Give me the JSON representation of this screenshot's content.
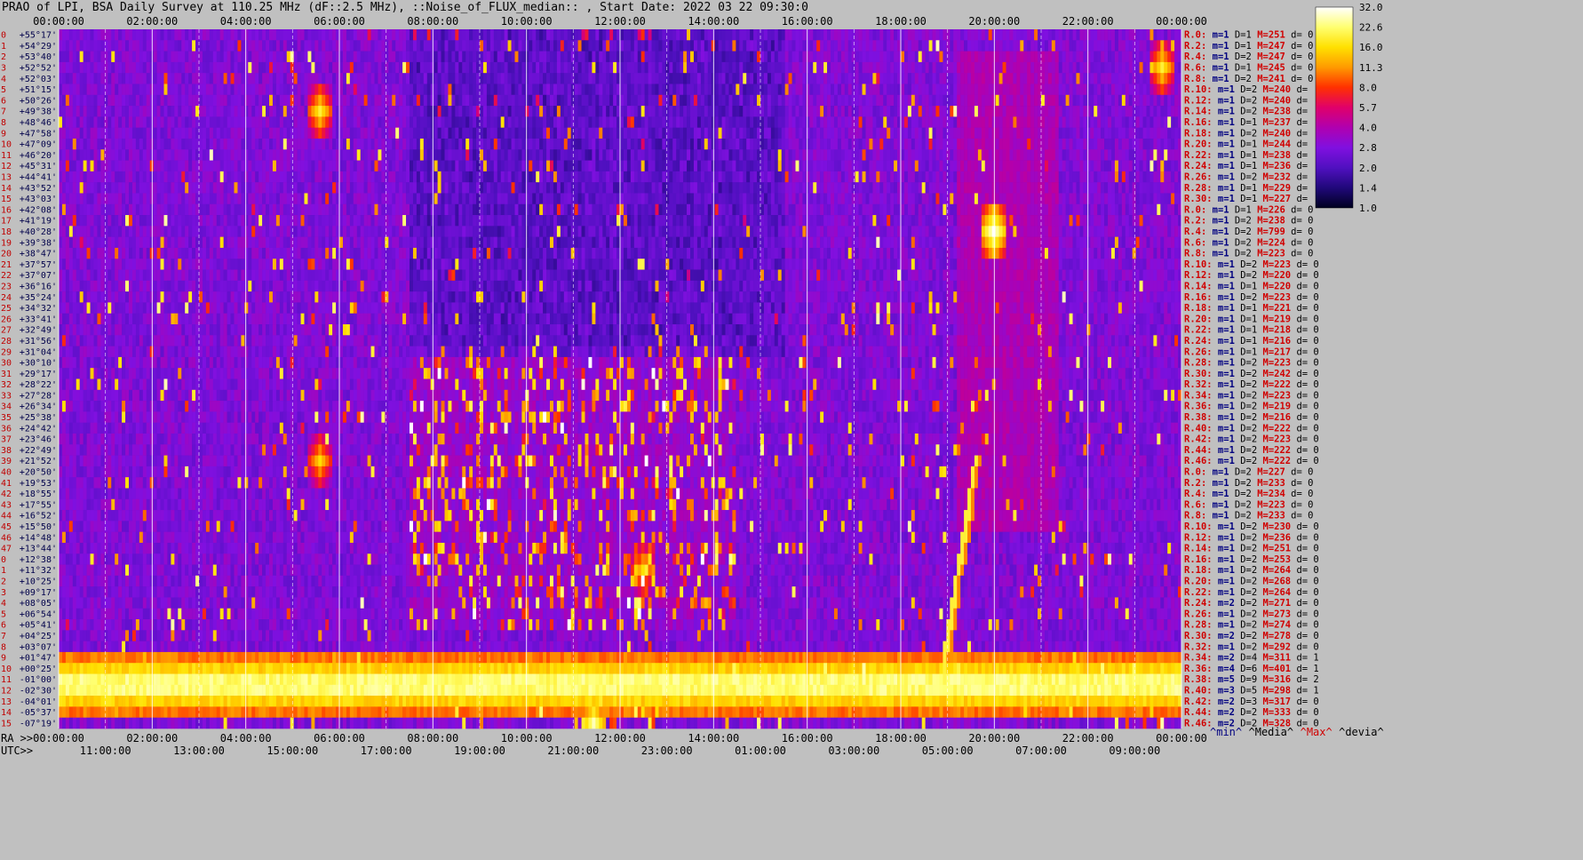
{
  "title": "PRAO of LPI, BSA Daily Survey at 110.25 MHz (dF::2.5 MHz), ::Noise_of_FLUX_median:: , Start Date: 2022 03 22 09:30:0",
  "chart_data": {
    "type": "heatmap",
    "title": "PRAO of LPI, BSA Daily Survey at 110.25 MHz (dF::2.5 MHz), ::Noise_of_FLUX_median:: , Start Date: 2022 03 22 09:30:0",
    "top_axis_ticks": [
      "00:00:00",
      "02:00:00",
      "04:00:00",
      "06:00:00",
      "08:00:00",
      "10:00:00",
      "12:00:00",
      "14:00:00",
      "16:00:00",
      "18:00:00",
      "20:00:00",
      "22:00:00",
      "00:00:00"
    ],
    "ra_prefix": "RA >>",
    "ra_ticks": [
      "00:00:00",
      "02:00:00",
      "04:00:00",
      "06:00:00",
      "08:00:00",
      "10:00:00",
      "12:00:00",
      "14:00:00",
      "16:00:00",
      "18:00:00",
      "20:00:00",
      "22:00:00",
      "00:00:00"
    ],
    "utc_prefix": "UTC>>",
    "utc_ticks": [
      "11:00:00",
      "13:00:00",
      "15:00:00",
      "17:00:00",
      "19:00:00",
      "21:00:00",
      "23:00:00",
      "01:00:00",
      "03:00:00",
      "05:00:00",
      "07:00:00",
      "09:00:00"
    ],
    "declination_labels": [
      "+55°17'",
      "+54°29'",
      "+53°40'",
      "+52°52'",
      "+52°03'",
      "+51°15'",
      "+50°26'",
      "+49°38'",
      "+48°46'",
      "+47°58'",
      "+47°09'",
      "+46°20'",
      "+45°31'",
      "+44°41'",
      "+43°52'",
      "+43°03'",
      "+42°08'",
      "+41°19'",
      "+40°28'",
      "+39°38'",
      "+38°47'",
      "+37°57'",
      "+37°07'",
      "+36°16'",
      "+35°24'",
      "+34°32'",
      "+33°41'",
      "+32°49'",
      "+31°56'",
      "+31°04'",
      "+30°10'",
      "+29°17'",
      "+28°22'",
      "+27°28'",
      "+26°34'",
      "+25°38'",
      "+24°42'",
      "+23°46'",
      "+22°49'",
      "+21°52'",
      "+20°50'",
      "+19°53'",
      "+18°55'",
      "+17°55'",
      "+16°52'",
      "+15°50'",
      "+14°48'",
      "+13°44'",
      "+12°38'",
      "+11°32'",
      "+10°25'",
      "+09°17'",
      "+08°05'",
      "+06°54'",
      "+05°41'",
      "+04°25'",
      "+03°07'",
      "+01°47'",
      "+00°25'",
      "-01°00'",
      "-02°30'",
      "-04°01'",
      "-05°37'",
      "-07°19'"
    ],
    "row_numbers": [
      "0",
      "1",
      "2",
      "3",
      "4",
      "5",
      "6",
      "7",
      "8",
      "9",
      "10",
      "11",
      "12",
      "13",
      "14",
      "15",
      "16",
      "17",
      "18",
      "19",
      "20",
      "21",
      "22",
      "23",
      "24",
      "25",
      "26",
      "27",
      "28",
      "29",
      "30",
      "31",
      "32",
      "33",
      "34",
      "35",
      "36",
      "37",
      "38",
      "39",
      "40",
      "41",
      "42",
      "43",
      "44",
      "45",
      "46",
      "47",
      "0",
      "1",
      "2",
      "3",
      "4",
      "5",
      "6",
      "7",
      "8",
      "9",
      "10",
      "11",
      "12",
      "13",
      "14",
      "15"
    ],
    "stats": [
      {
        "r": "R.0:",
        "m": "m=1",
        "d": "D=1",
        "M": "M=251",
        "dd": "d= 0"
      },
      {
        "r": "R.2:",
        "m": "m=1",
        "d": "D=1",
        "M": "M=247",
        "dd": "d= 0"
      },
      {
        "r": "R.4:",
        "m": "m=1",
        "d": "D=2",
        "M": "M=247",
        "dd": "d= 0"
      },
      {
        "r": "R.6:",
        "m": "m=1",
        "d": "D=1",
        "M": "M=245",
        "dd": "d= 0"
      },
      {
        "r": "R.8:",
        "m": "m=1",
        "d": "D=2",
        "M": "M=241",
        "dd": "d= 0"
      },
      {
        "r": "R.10:",
        "m": "m=1",
        "d": "D=2",
        "M": "M=240",
        "dd": "d="
      },
      {
        "r": "R.12:",
        "m": "m=1",
        "d": "D=2",
        "M": "M=240",
        "dd": "d="
      },
      {
        "r": "R.14:",
        "m": "m=1",
        "d": "D=2",
        "M": "M=238",
        "dd": "d="
      },
      {
        "r": "R.16:",
        "m": "m=1",
        "d": "D=1",
        "M": "M=237",
        "dd": "d="
      },
      {
        "r": "R.18:",
        "m": "m=1",
        "d": "D=2",
        "M": "M=240",
        "dd": "d="
      },
      {
        "r": "R.20:",
        "m": "m=1",
        "d": "D=1",
        "M": "M=244",
        "dd": "d="
      },
      {
        "r": "R.22:",
        "m": "m=1",
        "d": "D=1",
        "M": "M=238",
        "dd": "d="
      },
      {
        "r": "R.24:",
        "m": "m=1",
        "d": "D=1",
        "M": "M=236",
        "dd": "d="
      },
      {
        "r": "R.26:",
        "m": "m=1",
        "d": "D=2",
        "M": "M=232",
        "dd": "d="
      },
      {
        "r": "R.28:",
        "m": "m=1",
        "d": "D=1",
        "M": "M=229",
        "dd": "d="
      },
      {
        "r": "R.30:",
        "m": "m=1",
        "d": "D=1",
        "M": "M=227",
        "dd": "d="
      },
      {
        "r": "R.0:",
        "m": "m=1",
        "d": "D=1",
        "M": "M=226",
        "dd": "d= 0"
      },
      {
        "r": "R.2:",
        "m": "m=1",
        "d": "D=2",
        "M": "M=238",
        "dd": "d= 0"
      },
      {
        "r": "R.4:",
        "m": "m=1",
        "d": "D=2",
        "M": "M=799",
        "dd": "d= 0"
      },
      {
        "r": "R.6:",
        "m": "m=1",
        "d": "D=2",
        "M": "M=224",
        "dd": "d= 0"
      },
      {
        "r": "R.8:",
        "m": "m=1",
        "d": "D=2",
        "M": "M=223",
        "dd": "d= 0"
      },
      {
        "r": "R.10:",
        "m": "m=1",
        "d": "D=2",
        "M": "M=223",
        "dd": "d= 0"
      },
      {
        "r": "R.12:",
        "m": "m=1",
        "d": "D=2",
        "M": "M=220",
        "dd": "d= 0"
      },
      {
        "r": "R.14:",
        "m": "m=1",
        "d": "D=1",
        "M": "M=220",
        "dd": "d= 0"
      },
      {
        "r": "R.16:",
        "m": "m=1",
        "d": "D=2",
        "M": "M=223",
        "dd": "d= 0"
      },
      {
        "r": "R.18:",
        "m": "m=1",
        "d": "D=1",
        "M": "M=221",
        "dd": "d= 0"
      },
      {
        "r": "R.20:",
        "m": "m=1",
        "d": "D=1",
        "M": "M=219",
        "dd": "d= 0"
      },
      {
        "r": "R.22:",
        "m": "m=1",
        "d": "D=1",
        "M": "M=218",
        "dd": "d= 0"
      },
      {
        "r": "R.24:",
        "m": "m=1",
        "d": "D=1",
        "M": "M=216",
        "dd": "d= 0"
      },
      {
        "r": "R.26:",
        "m": "m=1",
        "d": "D=1",
        "M": "M=217",
        "dd": "d= 0"
      },
      {
        "r": "R.28:",
        "m": "m=1",
        "d": "D=2",
        "M": "M=223",
        "dd": "d= 0"
      },
      {
        "r": "R.30:",
        "m": "m=1",
        "d": "D=2",
        "M": "M=242",
        "dd": "d= 0"
      },
      {
        "r": "R.32:",
        "m": "m=1",
        "d": "D=2",
        "M": "M=222",
        "dd": "d= 0"
      },
      {
        "r": "R.34:",
        "m": "m=1",
        "d": "D=2",
        "M": "M=223",
        "dd": "d= 0"
      },
      {
        "r": "R.36:",
        "m": "m=1",
        "d": "D=2",
        "M": "M=219",
        "dd": "d= 0"
      },
      {
        "r": "R.38:",
        "m": "m=1",
        "d": "D=2",
        "M": "M=216",
        "dd": "d= 0"
      },
      {
        "r": "R.40:",
        "m": "m=1",
        "d": "D=2",
        "M": "M=222",
        "dd": "d= 0"
      },
      {
        "r": "R.42:",
        "m": "m=1",
        "d": "D=2",
        "M": "M=223",
        "dd": "d= 0"
      },
      {
        "r": "R.44:",
        "m": "m=1",
        "d": "D=2",
        "M": "M=222",
        "dd": "d= 0"
      },
      {
        "r": "R.46:",
        "m": "m=1",
        "d": "D=2",
        "M": "M=222",
        "dd": "d= 0"
      },
      {
        "r": "R.0:",
        "m": "m=1",
        "d": "D=2",
        "M": "M=227",
        "dd": "d= 0"
      },
      {
        "r": "R.2:",
        "m": "m=1",
        "d": "D=2",
        "M": "M=233",
        "dd": "d= 0"
      },
      {
        "r": "R.4:",
        "m": "m=1",
        "d": "D=2",
        "M": "M=234",
        "dd": "d= 0"
      },
      {
        "r": "R.6:",
        "m": "m=1",
        "d": "D=2",
        "M": "M=223",
        "dd": "d= 0"
      },
      {
        "r": "R.8:",
        "m": "m=1",
        "d": "D=2",
        "M": "M=233",
        "dd": "d= 0"
      },
      {
        "r": "R.10:",
        "m": "m=1",
        "d": "D=2",
        "M": "M=230",
        "dd": "d= 0"
      },
      {
        "r": "R.12:",
        "m": "m=1",
        "d": "D=2",
        "M": "M=236",
        "dd": "d= 0"
      },
      {
        "r": "R.14:",
        "m": "m=1",
        "d": "D=2",
        "M": "M=251",
        "dd": "d= 0"
      },
      {
        "r": "R.16:",
        "m": "m=1",
        "d": "D=2",
        "M": "M=253",
        "dd": "d= 0"
      },
      {
        "r": "R.18:",
        "m": "m=1",
        "d": "D=2",
        "M": "M=264",
        "dd": "d= 0"
      },
      {
        "r": "R.20:",
        "m": "m=1",
        "d": "D=2",
        "M": "M=268",
        "dd": "d= 0"
      },
      {
        "r": "R.22:",
        "m": "m=1",
        "d": "D=2",
        "M": "M=264",
        "dd": "d= 0"
      },
      {
        "r": "R.24:",
        "m": "m=2",
        "d": "D=2",
        "M": "M=271",
        "dd": "d= 0"
      },
      {
        "r": "R.26:",
        "m": "m=1",
        "d": "D=2",
        "M": "M=273",
        "dd": "d= 0"
      },
      {
        "r": "R.28:",
        "m": "m=1",
        "d": "D=2",
        "M": "M=274",
        "dd": "d= 0"
      },
      {
        "r": "R.30:",
        "m": "m=2",
        "d": "D=2",
        "M": "M=278",
        "dd": "d= 0"
      },
      {
        "r": "R.32:",
        "m": "m=1",
        "d": "D=2",
        "M": "M=292",
        "dd": "d= 0"
      },
      {
        "r": "R.34:",
        "m": "m=2",
        "d": "D=4",
        "M": "M=311",
        "dd": "d= 1"
      },
      {
        "r": "R.36:",
        "m": "m=4",
        "d": "D=6",
        "M": "M=401",
        "dd": "d= 1"
      },
      {
        "r": "R.38:",
        "m": "m=5",
        "d": "D=9",
        "M": "M=316",
        "dd": "d= 2"
      },
      {
        "r": "R.40:",
        "m": "m=3",
        "d": "D=5",
        "M": "M=298",
        "dd": "d= 1"
      },
      {
        "r": "R.42:",
        "m": "m=2",
        "d": "D=3",
        "M": "M=317",
        "dd": "d= 0"
      },
      {
        "r": "R.44:",
        "m": "m=2",
        "d": "D=2",
        "M": "M=333",
        "dd": "d= 0"
      },
      {
        "r": "R.46:",
        "m": "m=2",
        "d": "D=2",
        "M": "M=328",
        "dd": "d= 0"
      }
    ],
    "footer_legend": [
      {
        "label": "^min^",
        "color": "#000080"
      },
      {
        "label": "^Media^",
        "color": "#000000"
      },
      {
        "label": "^Max^",
        "color": "#d00000"
      },
      {
        "label": "^devia^",
        "color": "#000000"
      }
    ],
    "colorbar": {
      "ticks": [
        "32.0",
        "22.6",
        "16.0",
        "11.3",
        "8.0",
        "5.7",
        "4.0",
        "2.8",
        "2.0",
        "1.4",
        "1.0"
      ],
      "colors": [
        "#ffffff",
        "#ffff70",
        "#ffe000",
        "#ff9a00",
        "#ff3000",
        "#e0006a",
        "#b000b0",
        "#8010e0",
        "#5010c0",
        "#20087a",
        "#000020"
      ]
    },
    "features": [
      {
        "type": "band",
        "ra_from": 0.0,
        "ra_to": 24.0,
        "row_from": 57,
        "row_to": 62,
        "intensity": 0.92
      },
      {
        "type": "point",
        "ra": 20.0,
        "row": 17.8,
        "intensity": 1.0
      },
      {
        "type": "point",
        "ra": 11.4,
        "row": 63.0,
        "intensity": 0.95
      },
      {
        "type": "point",
        "ra": 23.6,
        "row": 3.0,
        "intensity": 0.85
      },
      {
        "type": "point",
        "ra": 5.6,
        "row": 6.6,
        "intensity": 0.85
      },
      {
        "type": "point",
        "ra": 5.55,
        "row": 39.0,
        "intensity": 0.8
      },
      {
        "type": "point",
        "ra": 12.5,
        "row": 48.5,
        "intensity": 0.8
      },
      {
        "type": "diagonal",
        "ra_from": 18.9,
        "row_from": 58.0,
        "ra_to": 19.6,
        "row_to": 39.0,
        "intensity": 0.85
      },
      {
        "type": "glow",
        "ra_from": 19.2,
        "ra_to": 21.4,
        "row_from": 2,
        "row_to": 45,
        "intensity": 0.35
      }
    ]
  }
}
